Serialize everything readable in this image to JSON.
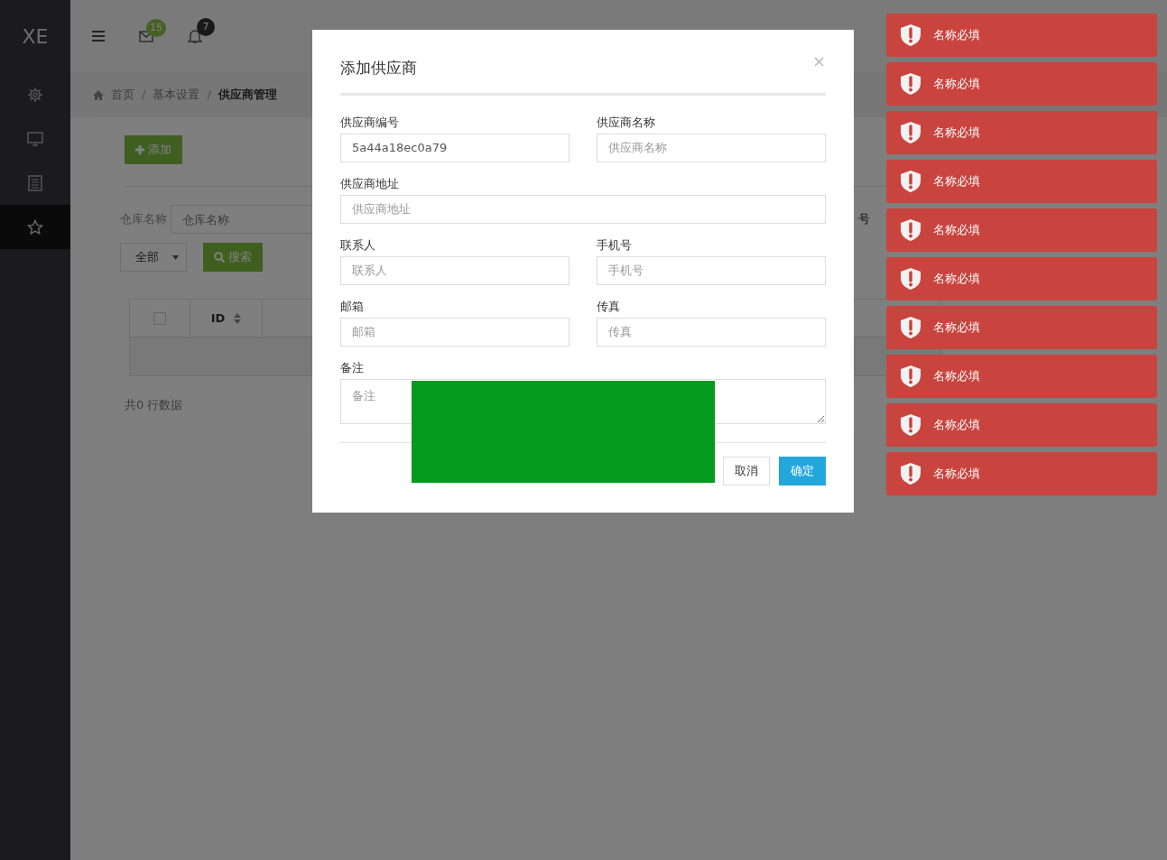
{
  "sidebar": {
    "logo": "XE",
    "items": [
      {
        "selected": false
      },
      {
        "selected": false
      },
      {
        "selected": false
      },
      {
        "selected": true
      }
    ]
  },
  "header": {
    "mail_count": "15",
    "bell_count": "7"
  },
  "breadcrumb": [
    {
      "kind": "link",
      "text": "首页",
      "current": false
    },
    {
      "kind": "separator",
      "text": "/"
    },
    {
      "kind": "link",
      "text": "基本设置",
      "current": false
    },
    {
      "kind": "separator",
      "text": "/"
    },
    {
      "kind": "link",
      "text": "供应商管理",
      "current": true
    }
  ],
  "toolbar": {
    "add_button": "添加"
  },
  "filters": {
    "label": "仓库名称",
    "placeholder": "仓库名称",
    "select": "全部",
    "search_button": "搜索",
    "label_2": "号"
  },
  "table": {
    "select_all_checked": false,
    "columns": [
      "ID"
    ]
  },
  "footer_text": "共0 行数据",
  "modal": {
    "title": "添加供应商",
    "close": "×",
    "fields": [
      {
        "kind": "half",
        "label": "供应商编号",
        "value": "5a44a18ec0a79"
      },
      {
        "kind": "half",
        "label": "供应商名称",
        "placeholder": "供应商名称"
      },
      {
        "kind": "full",
        "label": "供应商地址",
        "placeholder": "供应商地址"
      },
      {
        "kind": "half",
        "label": "联系人",
        "placeholder": "联系人"
      },
      {
        "kind": "half",
        "label": "手机号",
        "placeholder": "手机号"
      },
      {
        "kind": "half",
        "label": "邮箱",
        "placeholder": "邮箱"
      },
      {
        "kind": "half",
        "label": "传真",
        "placeholder": "传真"
      },
      {
        "kind": "textarea",
        "label": "备注",
        "placeholder": "备注"
      }
    ],
    "buttons": [
      {
        "kind": "default",
        "label": "取消"
      },
      {
        "kind": "primary",
        "label": "确定"
      }
    ]
  },
  "toasts": [
    {
      "text": "名称必填"
    },
    {
      "text": "名称必填"
    },
    {
      "text": "名称必填"
    },
    {
      "text": "名称必填"
    },
    {
      "text": "名称必填"
    },
    {
      "text": "名称必填"
    },
    {
      "text": "名称必填"
    },
    {
      "text": "名称必填"
    },
    {
      "text": "名称必填"
    },
    {
      "text": "名称必填"
    }
  ]
}
